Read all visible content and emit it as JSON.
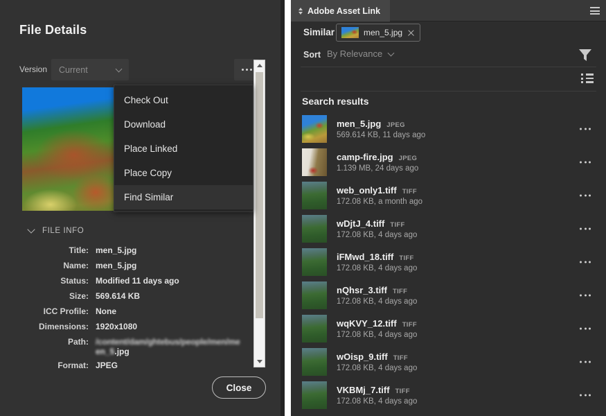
{
  "left_panel": {
    "title": "File Details",
    "version": {
      "label": "Version",
      "value": "Current",
      "chevron_icon": "chevron-down-icon"
    },
    "more_button": {
      "icon": "more-options-icon",
      "label": "..."
    },
    "preview": {
      "alt_name": "men_5.jpg"
    },
    "context_menu": {
      "items": [
        {
          "label": "Check Out",
          "highlighted": false
        },
        {
          "label": "Download",
          "highlighted": false
        },
        {
          "label": "Place Linked",
          "highlighted": false
        },
        {
          "label": "Place Copy",
          "highlighted": false
        },
        {
          "label": "Find Similar",
          "highlighted": true
        }
      ]
    },
    "file_info": {
      "section_label": "FILE INFO",
      "caret_icon": "chevron-down-icon",
      "rows": [
        {
          "key": "Title:",
          "value": "men_5.jpg"
        },
        {
          "key": "Name:",
          "value": "men_5.jpg"
        },
        {
          "key": "Status:",
          "value": "Modified 11 days ago"
        },
        {
          "key": "Size:",
          "value": "569.614 KB"
        },
        {
          "key": "ICC Profile:",
          "value": "None"
        },
        {
          "key": "Dimensions:",
          "value": "1920x1080"
        }
      ],
      "path_row": {
        "key": "Path:",
        "blurred_line": "/content/dam/ghtebus/people/men/me",
        "tail_blurred": "en_5",
        "tail_clear": ".jpg"
      },
      "format_row": {
        "key": "Format:",
        "value": "JPEG"
      }
    },
    "scrollbar": {
      "up_icon": "scroll-up-arrow-icon",
      "down_icon": "scroll-down-arrow-icon"
    },
    "close_button": "Close"
  },
  "right_panel": {
    "tab": {
      "label": "Adobe Asset Link",
      "icon": "panel-collapse-icon"
    },
    "panel_menu_icon": "hamburger-menu-icon",
    "similar": {
      "label": "Similar",
      "chip_name": "men_5.jpg",
      "chip_close_icon": "close-icon"
    },
    "sort": {
      "label": "Sort",
      "value": "By Relevance",
      "chevron_icon": "chevron-down-icon"
    },
    "filter_icon": "filter-funnel-icon",
    "view_mode_icon": "list-view-icon",
    "search_results_title": "Search results",
    "results": [
      {
        "name": "men_5.jpg",
        "format": "JPEG",
        "meta": "569.614 KB, 11 days ago",
        "thumb": "hero"
      },
      {
        "name": "camp-fire.jpg",
        "format": "JPEG",
        "meta": "1.139 MB, 24 days ago",
        "thumb": "fire"
      },
      {
        "name": "web_only1.tiff",
        "format": "TIFF",
        "meta": "172.08 KB, a month ago",
        "thumb": "land"
      },
      {
        "name": "wDjtJ_4.tiff",
        "format": "TIFF",
        "meta": "172.08 KB, 4 days ago",
        "thumb": "land"
      },
      {
        "name": "iFMwd_18.tiff",
        "format": "TIFF",
        "meta": "172.08 KB, 4 days ago",
        "thumb": "land"
      },
      {
        "name": "nQhsr_3.tiff",
        "format": "TIFF",
        "meta": "172.08 KB, 4 days ago",
        "thumb": "land"
      },
      {
        "name": "wqKVY_12.tiff",
        "format": "TIFF",
        "meta": "172.08 KB, 4 days ago",
        "thumb": "land"
      },
      {
        "name": "wOisp_9.tiff",
        "format": "TIFF",
        "meta": "172.08 KB, 4 days ago",
        "thumb": "land"
      },
      {
        "name": "VKBMj_7.tiff",
        "format": "TIFF",
        "meta": "172.08 KB, 4 days ago",
        "thumb": "land"
      }
    ],
    "row_more_icon": "more-options-icon"
  },
  "colors": {
    "panel_bg": "#323232",
    "right_panel_bg": "#2d2d2d",
    "menu_bg": "#262626",
    "menu_highlight": "#333333",
    "text_primary": "#efefef",
    "text_secondary": "#a8a8a8"
  }
}
